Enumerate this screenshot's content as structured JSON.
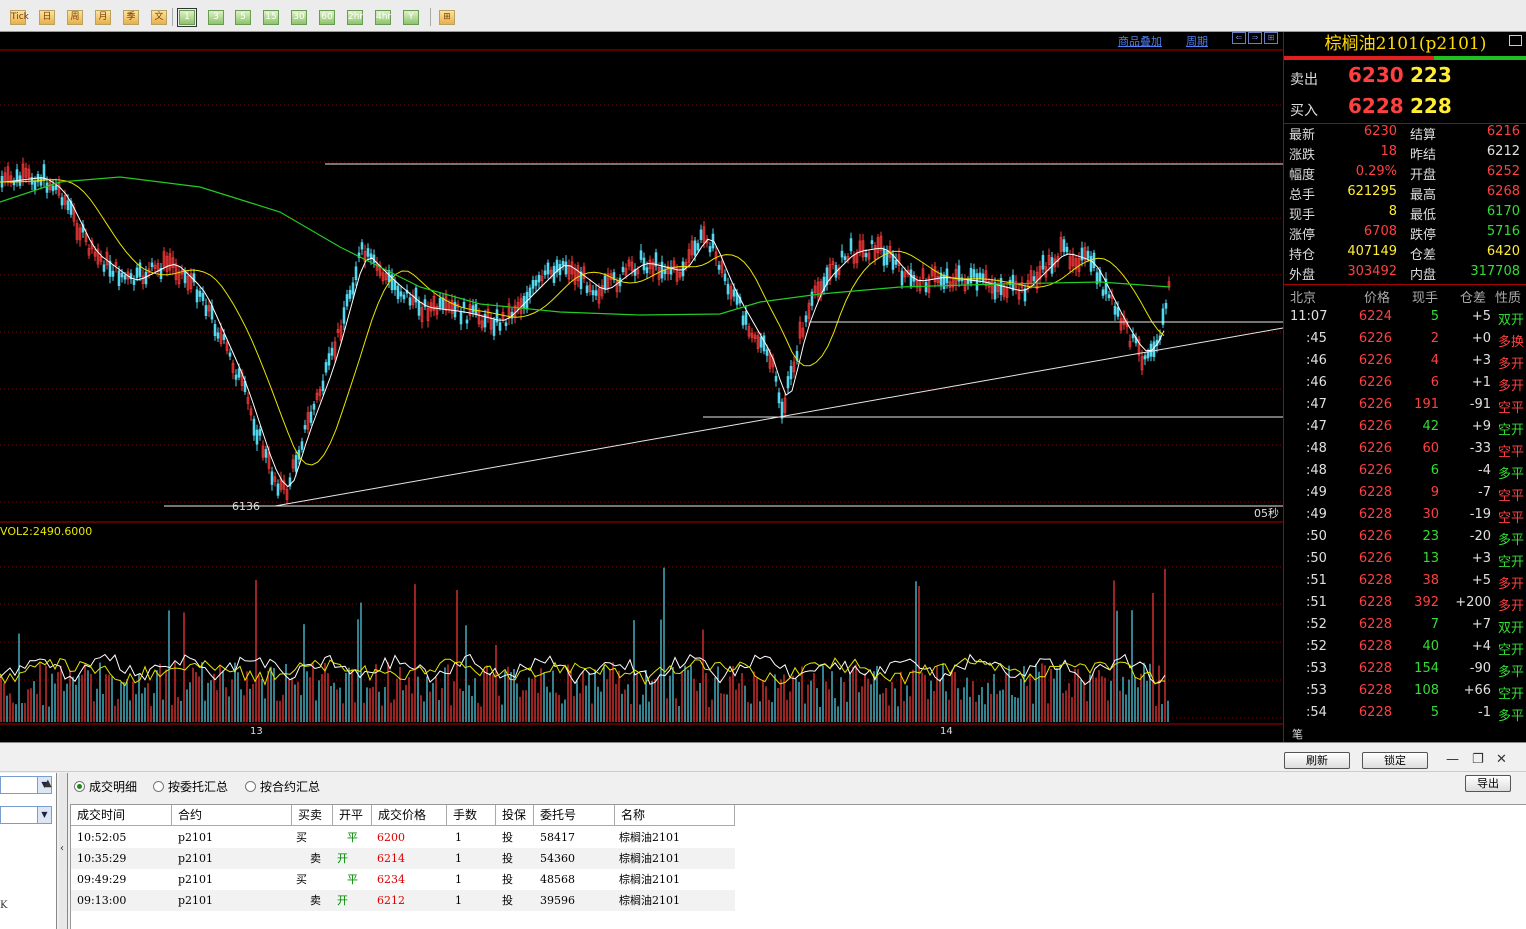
{
  "toolbar": {
    "buttons": [
      {
        "label": "Tick",
        "style": "orange"
      },
      {
        "label": "日",
        "style": "orange"
      },
      {
        "label": "周",
        "style": "orange"
      },
      {
        "label": "月",
        "style": "orange"
      },
      {
        "label": "季",
        "style": "orange"
      },
      {
        "label": "文",
        "style": "orange"
      },
      {
        "label": "1",
        "style": "green-selected"
      },
      {
        "label": "3",
        "style": "green"
      },
      {
        "label": "5",
        "style": "green"
      },
      {
        "label": "15",
        "style": "green"
      },
      {
        "label": "30",
        "style": "green"
      },
      {
        "label": "60",
        "style": "green"
      },
      {
        "label": "2hr",
        "style": "green"
      },
      {
        "label": "4hr",
        "style": "green"
      },
      {
        "label": "Y",
        "style": "green"
      },
      {
        "label": "⊞",
        "style": "orange"
      }
    ]
  },
  "chart": {
    "overlay_link": "商品叠加",
    "period_link": "周期",
    "low_label": "6136",
    "vol_label": "VOL2:2490.6000",
    "x_labels": [
      "13",
      "14"
    ],
    "sec_label": "05秒",
    "colors": {
      "up": "#ff3b3b",
      "down": "#54d8f0",
      "ma_white": "#ffffff",
      "ma_yellow": "#e6e600",
      "ma_green": "#22cc22",
      "grid": "#8a0000"
    }
  },
  "quote": {
    "title": "棕榈油2101(p2101)",
    "sell": {
      "label": "卖出",
      "price": "6230",
      "qty": "223"
    },
    "buy": {
      "label": "买入",
      "price": "6228",
      "qty": "228"
    },
    "stats_left": [
      {
        "k": "最新",
        "v": "6230",
        "c": "red"
      },
      {
        "k": "涨跌",
        "v": "18",
        "c": "red"
      },
      {
        "k": "幅度",
        "v": "0.29%",
        "c": "red"
      },
      {
        "k": "总手",
        "v": "621295",
        "c": "yel"
      },
      {
        "k": "现手",
        "v": "8",
        "c": "yel"
      },
      {
        "k": "涨停",
        "v": "6708",
        "c": "red"
      },
      {
        "k": "持仓",
        "v": "407149",
        "c": "yel"
      },
      {
        "k": "外盘",
        "v": "303492",
        "c": "red"
      }
    ],
    "stats_right": [
      {
        "k": "结算",
        "v": "6216",
        "c": "red"
      },
      {
        "k": "昨结",
        "v": "6212",
        "c": "wht"
      },
      {
        "k": "开盘",
        "v": "6252",
        "c": "red"
      },
      {
        "k": "最高",
        "v": "6268",
        "c": "red"
      },
      {
        "k": "最低",
        "v": "6170",
        "c": "grn"
      },
      {
        "k": "跌停",
        "v": "5716",
        "c": "grn"
      },
      {
        "k": "仓差",
        "v": "6420",
        "c": "yel"
      },
      {
        "k": "内盘",
        "v": "317708",
        "c": "grn"
      }
    ],
    "tick_header": {
      "time": "北京",
      "price": "价格",
      "vol": "现手",
      "oi": "仓差",
      "nature": "性质"
    },
    "ticks": [
      {
        "t": "11:07",
        "p": "6224",
        "v": "5",
        "o": "+5",
        "n": "双开",
        "vc": "grn",
        "nc": "grn"
      },
      {
        "t": ":45",
        "p": "6226",
        "v": "2",
        "o": "+0",
        "n": "多换",
        "vc": "red",
        "nc": "red"
      },
      {
        "t": ":46",
        "p": "6226",
        "v": "4",
        "o": "+3",
        "n": "多开",
        "vc": "red",
        "nc": "red"
      },
      {
        "t": ":46",
        "p": "6226",
        "v": "6",
        "o": "+1",
        "n": "多开",
        "vc": "red",
        "nc": "red"
      },
      {
        "t": ":47",
        "p": "6226",
        "v": "191",
        "o": "-91",
        "n": "空平",
        "vc": "red",
        "nc": "red"
      },
      {
        "t": ":47",
        "p": "6226",
        "v": "42",
        "o": "+9",
        "n": "空开",
        "vc": "grn",
        "nc": "grn"
      },
      {
        "t": ":48",
        "p": "6226",
        "v": "60",
        "o": "-33",
        "n": "空平",
        "vc": "red",
        "nc": "red"
      },
      {
        "t": ":48",
        "p": "6226",
        "v": "6",
        "o": "-4",
        "n": "多平",
        "vc": "grn",
        "nc": "grn"
      },
      {
        "t": ":49",
        "p": "6228",
        "v": "9",
        "o": "-7",
        "n": "空平",
        "vc": "red",
        "nc": "red"
      },
      {
        "t": ":49",
        "p": "6228",
        "v": "30",
        "o": "-19",
        "n": "空平",
        "vc": "red",
        "nc": "red"
      },
      {
        "t": ":50",
        "p": "6226",
        "v": "23",
        "o": "-20",
        "n": "多平",
        "vc": "grn",
        "nc": "grn"
      },
      {
        "t": ":50",
        "p": "6226",
        "v": "13",
        "o": "+3",
        "n": "空开",
        "vc": "grn",
        "nc": "grn"
      },
      {
        "t": ":51",
        "p": "6228",
        "v": "38",
        "o": "+5",
        "n": "多开",
        "vc": "red",
        "nc": "red"
      },
      {
        "t": ":51",
        "p": "6228",
        "v": "392",
        "o": "+200",
        "n": "多开",
        "vc": "red",
        "nc": "red"
      },
      {
        "t": ":52",
        "p": "6228",
        "v": "7",
        "o": "+7",
        "n": "双开",
        "vc": "grn",
        "nc": "grn"
      },
      {
        "t": ":52",
        "p": "6228",
        "v": "40",
        "o": "+4",
        "n": "空开",
        "vc": "grn",
        "nc": "grn"
      },
      {
        "t": ":53",
        "p": "6228",
        "v": "154",
        "o": "-90",
        "n": "多平",
        "vc": "grn",
        "nc": "grn"
      },
      {
        "t": ":53",
        "p": "6228",
        "v": "108",
        "o": "+66",
        "n": "空开",
        "vc": "grn",
        "nc": "grn"
      },
      {
        "t": ":54",
        "p": "6228",
        "v": "5",
        "o": "-1",
        "n": "多平",
        "vc": "grn",
        "nc": "grn"
      }
    ],
    "bottom_tab": "笔"
  },
  "bottom": {
    "refresh": "刷新",
    "lock": "锁定",
    "export": "导出",
    "radios": [
      "成交明细",
      "按委托汇总",
      "按合约汇总"
    ],
    "left_text": "K",
    "columns": [
      "成交时间",
      "合约",
      "买卖",
      "开平",
      "成交价格",
      "手数",
      "投保",
      "委托号",
      "名称"
    ],
    "rows": [
      [
        "10:52:05",
        "p2101",
        "买",
        "平",
        "6200",
        "1",
        "投",
        "58417",
        "棕榈油2101"
      ],
      [
        "10:35:29",
        "p2101",
        "卖",
        "开",
        "6214",
        "1",
        "投",
        "54360",
        "棕榈油2101"
      ],
      [
        "09:49:29",
        "p2101",
        "买",
        "平",
        "6234",
        "1",
        "投",
        "48568",
        "棕榈油2101"
      ],
      [
        "09:13:00",
        "p2101",
        "卖",
        "开",
        "6212",
        "1",
        "投",
        "39596",
        "棕榈油2101"
      ]
    ]
  }
}
